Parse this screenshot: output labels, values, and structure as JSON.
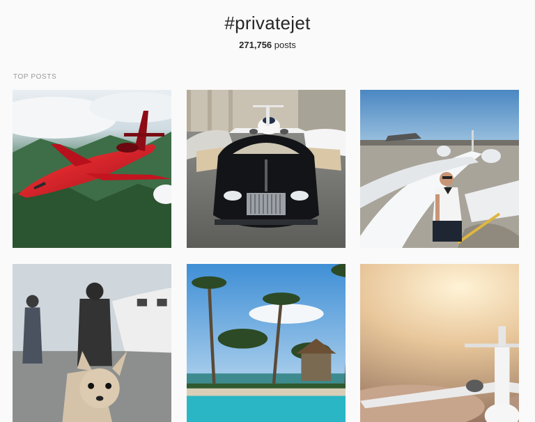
{
  "header": {
    "hashtag": "#privatejet",
    "post_count": "271,756",
    "post_suffix": " posts"
  },
  "section": {
    "label": "TOP POSTS"
  },
  "posts": [
    {
      "subject": "red private jet flying over green mountains"
    },
    {
      "subject": "black Rolls-Royce convertible parked in front of private jet and supercars"
    },
    {
      "subject": "pilot in uniform standing on white private jet wing"
    },
    {
      "subject": "people with small dog next to private jet on tarmac"
    },
    {
      "subject": "tropical resort pool with palm trees"
    },
    {
      "subject": "white private jet flying above clouds at sunset"
    }
  ]
}
